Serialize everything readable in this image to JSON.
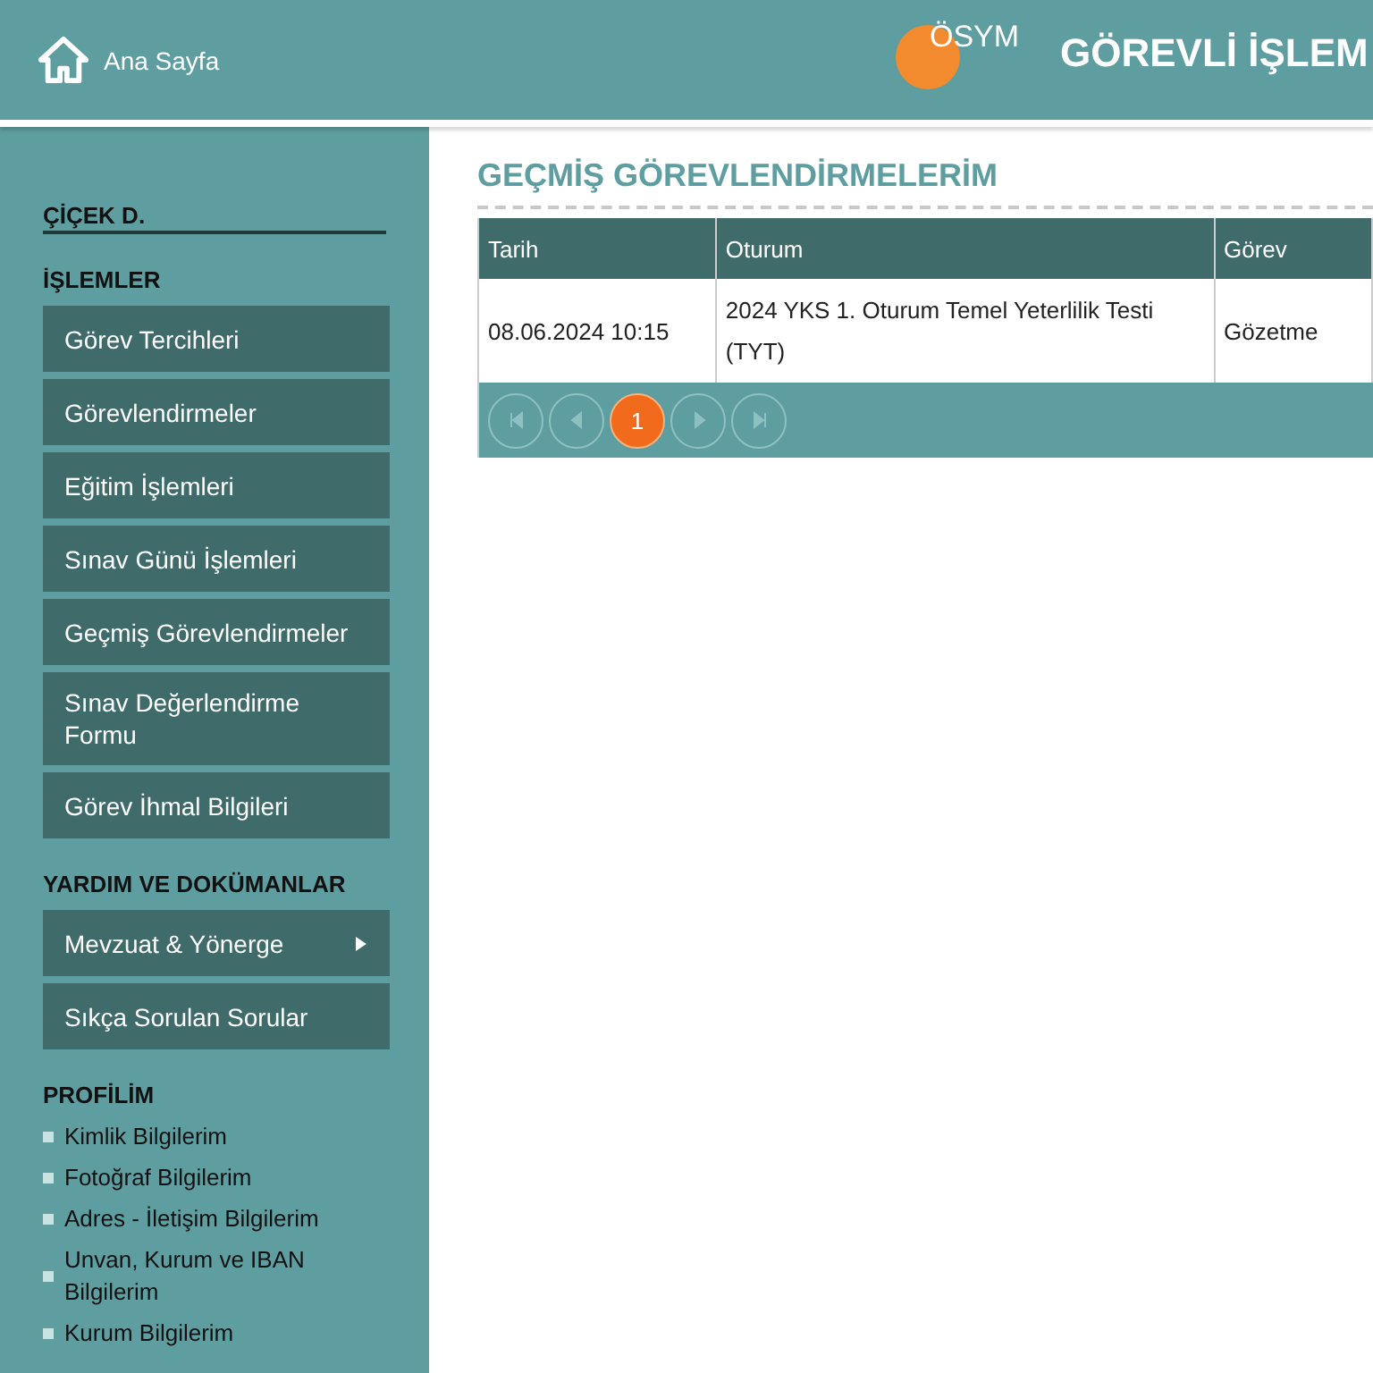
{
  "header": {
    "home_link": "Ana Sayfa",
    "logo_text": "ÖSYM",
    "title": "GÖREVLİ İŞLEM"
  },
  "sidebar": {
    "user": "ÇİÇEK D.",
    "sections": [
      {
        "title": "İŞLEMLER",
        "kind": "buttons",
        "items": [
          {
            "label": "Görev Tercihleri",
            "has_submenu": false
          },
          {
            "label": "Görevlendirmeler",
            "has_submenu": false
          },
          {
            "label": "Eğitim İşlemleri",
            "has_submenu": false
          },
          {
            "label": "Sınav Günü İşlemleri",
            "has_submenu": false
          },
          {
            "label": "Geçmiş Görevlendirmeler",
            "has_submenu": false
          },
          {
            "label": "Sınav Değerlendirme Formu",
            "has_submenu": false
          },
          {
            "label": "Görev İhmal Bilgileri",
            "has_submenu": false
          }
        ]
      },
      {
        "title": "YARDIM VE DOKÜMANLAR",
        "kind": "buttons",
        "items": [
          {
            "label": "Mevzuat & Yönerge",
            "has_submenu": true
          },
          {
            "label": "Sıkça Sorulan Sorular",
            "has_submenu": false
          }
        ]
      },
      {
        "title": "PROFİLİM",
        "kind": "links",
        "items": [
          {
            "label": "Kimlik Bilgilerim"
          },
          {
            "label": "Fotoğraf Bilgilerim"
          },
          {
            "label": "Adres - İletişim Bilgilerim"
          },
          {
            "label": "Unvan, Kurum ve IBAN Bilgilerim"
          },
          {
            "label": "Kurum Bilgilerim"
          }
        ]
      }
    ]
  },
  "main": {
    "title": "GEÇMİŞ GÖREVLENDİRMELERİM",
    "table": {
      "columns": [
        "Tarih",
        "Oturum",
        "Görev"
      ],
      "rows": [
        [
          "08.06.2024 10:15",
          "2024 YKS 1. Oturum Temel Yeterlilik Testi (TYT)",
          "Gözetme"
        ]
      ]
    },
    "pager": {
      "pages": [
        {
          "label": "1",
          "selected": true
        }
      ]
    }
  }
}
